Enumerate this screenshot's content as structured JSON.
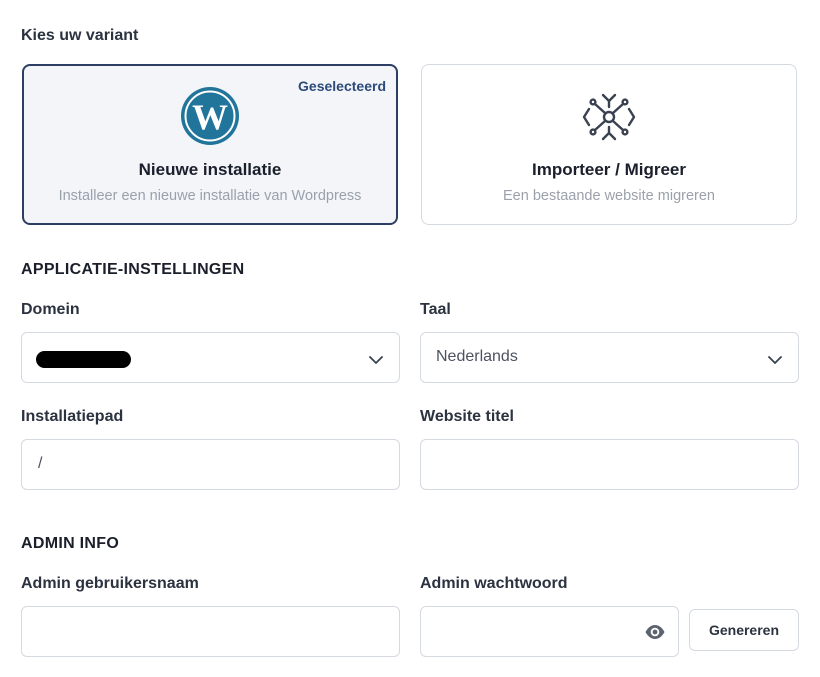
{
  "variant": {
    "label": "Kies uw variant",
    "options": [
      {
        "title": "Nieuwe installatie",
        "subtitle": "Installeer een nieuwe installatie van Wordpress",
        "badge": "Geselecteerd",
        "icon": "wordpress-icon",
        "selected": true
      },
      {
        "title": "Importeer / Migreer",
        "subtitle": "Een bestaande website migreren",
        "icon": "migrate-icon",
        "selected": false
      }
    ]
  },
  "app_settings": {
    "heading": "APPLICATIE-INSTELLINGEN",
    "domain": {
      "label": "Domein",
      "value": ""
    },
    "language": {
      "label": "Taal",
      "value": "Nederlands"
    },
    "install_path": {
      "label": "Installatiepad",
      "value": "/"
    },
    "site_title": {
      "label": "Website titel",
      "value": ""
    }
  },
  "admin": {
    "heading": "ADMIN INFO",
    "username": {
      "label": "Admin gebruikersnaam",
      "value": ""
    },
    "password": {
      "label": "Admin wachtwoord",
      "value": ""
    },
    "generate_label": "Genereren"
  },
  "colors": {
    "selected_border": "#2c3e63",
    "selected_bg": "#f3f5f9",
    "wordpress_blue": "#21759b",
    "input_border": "#d5d9e0"
  }
}
